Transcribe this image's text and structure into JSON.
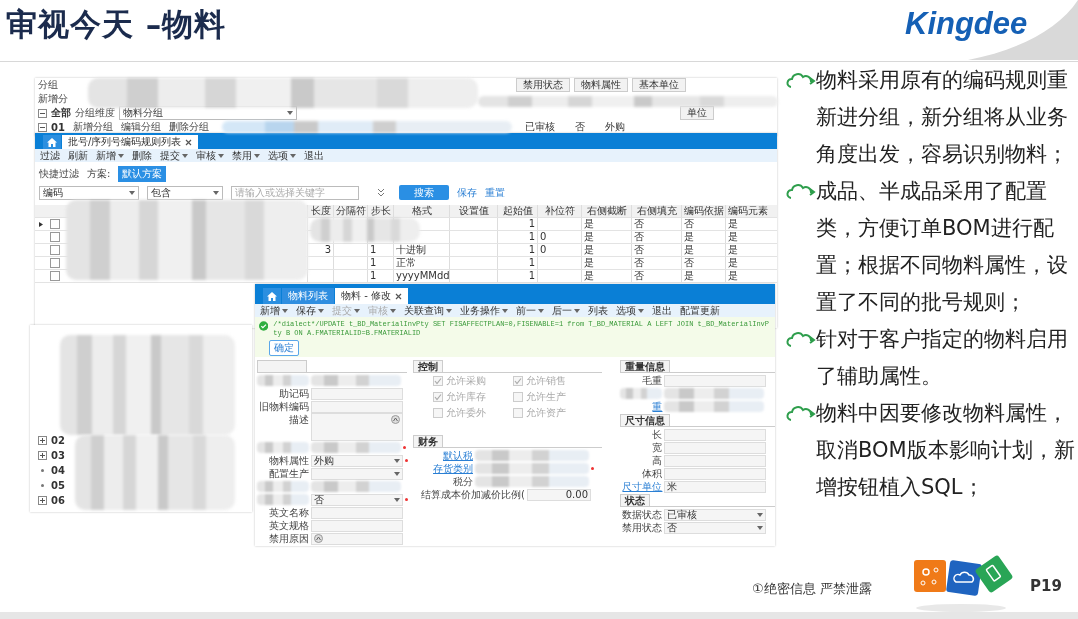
{
  "header": {
    "title": "审视今天 –物料",
    "logo": "Kingdee"
  },
  "group_window": {
    "labels": [
      "分组",
      "新增分"
    ],
    "tree_root": "全部",
    "dimension_label": "分组维度",
    "dimension_value": "物料分组",
    "node_code": "01",
    "node_actions": [
      "新增分组",
      "编辑分组",
      "删除分组"
    ],
    "columns": [
      "禁用状态",
      "物料属性",
      "基本单位"
    ],
    "columns_2": [
      "单位"
    ],
    "row": [
      "已审核",
      "否",
      "外购"
    ]
  },
  "rule_list_window": {
    "tabs": [
      {
        "label": "批号/序列号编码规则列表",
        "selected": true,
        "closable": true
      }
    ],
    "toolbar": [
      {
        "label": "过滤",
        "dropdown": false
      },
      {
        "label": "刷新",
        "dropdown": false
      },
      {
        "label": "新增",
        "dropdown": true
      },
      {
        "label": "删除",
        "dropdown": false
      },
      {
        "label": "提交",
        "dropdown": true
      },
      {
        "label": "审核",
        "dropdown": true
      },
      {
        "label": "禁用",
        "dropdown": true
      },
      {
        "label": "选项",
        "dropdown": true
      },
      {
        "label": "退出",
        "dropdown": false
      }
    ],
    "quick_filter": "快捷过滤",
    "scheme_label": "方案:",
    "scheme": "默认方案",
    "filter": {
      "field": "编码",
      "operator": "包含",
      "placeholder": "请输入或选择关键字"
    },
    "search_button": "搜索",
    "links": [
      "保存",
      "重置"
    ],
    "table": {
      "columns": [
        "长度",
        "分隔符",
        "步长",
        "格式",
        "设置值",
        "起始值",
        "补位符",
        "右侧截断",
        "右侧填充",
        "编码依据",
        "编码元素"
      ],
      "rows": [
        {
          "current": true,
          "checked": false,
          "cells": [
            "",
            "",
            "",
            "",
            "",
            "1",
            "",
            "是",
            "否",
            "否",
            "是"
          ]
        },
        {
          "current": false,
          "checked": false,
          "cells": [
            "",
            "",
            "",
            "",
            "",
            "1",
            "0",
            "是",
            "否",
            "是",
            "是"
          ]
        },
        {
          "current": false,
          "checked": false,
          "cells": [
            "3",
            "",
            "1",
            "十进制",
            "",
            "1",
            "0",
            "是",
            "否",
            "是",
            "是"
          ]
        },
        {
          "current": false,
          "checked": false,
          "cells": [
            "",
            "",
            "1",
            "正常",
            "",
            "1",
            "",
            "是",
            "否",
            "否",
            "是"
          ]
        },
        {
          "current": false,
          "checked": false,
          "cells": [
            "",
            "",
            "1",
            "yyyyMMdd",
            "",
            "1",
            "",
            "是",
            "否",
            "是",
            "是"
          ]
        }
      ]
    }
  },
  "material_window": {
    "tabs": [
      {
        "label": "物料列表",
        "selected": false,
        "closable": false
      },
      {
        "label": "物料 - 修改",
        "selected": true,
        "closable": true
      }
    ],
    "toolbar": [
      {
        "label": "新增",
        "dropdown": true,
        "disabled": false
      },
      {
        "label": "保存",
        "dropdown": true,
        "disabled": false
      },
      {
        "label": "提交",
        "dropdown": true,
        "disabled": true
      },
      {
        "label": "审核",
        "dropdown": true,
        "disabled": true
      },
      {
        "label": "关联查询",
        "dropdown": true,
        "disabled": false
      },
      {
        "label": "业务操作",
        "dropdown": true,
        "disabled": false
      },
      {
        "label": "前一",
        "dropdown": true,
        "disabled": false
      },
      {
        "label": "后一",
        "dropdown": true,
        "disabled": false
      },
      {
        "label": "列表",
        "dropdown": false,
        "disabled": false
      },
      {
        "label": "选项",
        "dropdown": true,
        "disabled": false
      },
      {
        "label": "退出",
        "dropdown": false,
        "disabled": false
      },
      {
        "label": "配置更新",
        "dropdown": false,
        "disabled": false
      }
    ],
    "message": "/*dialect*/UPDATE  t_BD_MaterialInvPty SET FISAFFECTPLAN=0,FISENABLE=1 from T_BD_MATERIAL A LEFT  JOIN t_BD_MaterialInvPty B ON A.FMATERIALID=B.FMATERIALID",
    "ok_button": "确定",
    "basic": {
      "fields": [
        {
          "kind": "text",
          "obscured": true
        },
        {
          "label": "助记码",
          "kind": "text"
        },
        {
          "label": "旧物料编码",
          "kind": "text"
        },
        {
          "label": "描述",
          "kind": "textarea"
        },
        {
          "kind": "text",
          "required": true,
          "obscured": true
        },
        {
          "label": "物料属性",
          "kind": "select",
          "value": "外购",
          "required": true
        },
        {
          "label": "配置生产",
          "kind": "select"
        },
        {
          "kind": "text",
          "obscured": true
        },
        {
          "kind": "select",
          "value": "否",
          "required": true
        },
        {
          "label": "英文名称",
          "kind": "text"
        },
        {
          "label": "英文规格",
          "kind": "text"
        },
        {
          "label": "禁用原因",
          "kind": "lookup"
        }
      ]
    },
    "control": {
      "title": "控制",
      "options": [
        {
          "label": "允许采购",
          "checked": true
        },
        {
          "label": "允许销售",
          "checked": true
        },
        {
          "label": "允许库存",
          "checked": true
        },
        {
          "label": "允许生产",
          "checked": false
        },
        {
          "label": "允许委外",
          "checked": false
        },
        {
          "label": "允许资产",
          "checked": false
        }
      ]
    },
    "finance": {
      "title": "财务",
      "fields": [
        {
          "label": "默认税",
          "kind": "text",
          "link": true,
          "obscured": true
        },
        {
          "label": "存货类别",
          "kind": "text",
          "link": true,
          "required": true,
          "obscured": true
        },
        {
          "label": "税分",
          "kind": "text",
          "obscured": true
        },
        {
          "label": "结算成本价加减价比例(",
          "kind": "text",
          "value": "0.00"
        }
      ]
    },
    "weight": {
      "title": "重量信息",
      "fields": [
        {
          "label": "毛重",
          "kind": "text"
        },
        {
          "kind": "text",
          "obscured": true
        },
        {
          "label": "重",
          "kind": "text",
          "link": true,
          "obscured": true
        }
      ]
    },
    "size": {
      "title": "尺寸信息",
      "fields": [
        {
          "label": "长",
          "kind": "text"
        },
        {
          "label": "宽",
          "kind": "text"
        },
        {
          "label": "高",
          "kind": "text"
        },
        {
          "label": "体积",
          "kind": "text"
        },
        {
          "label": "尺寸单位",
          "kind": "text",
          "link": true,
          "value": "米"
        }
      ]
    },
    "status": {
      "title": "状态",
      "fields": [
        {
          "label": "数据状态",
          "kind": "select",
          "value": "已审核"
        },
        {
          "label": "禁用状态",
          "kind": "select",
          "value": "否"
        }
      ]
    }
  },
  "tree_panel": {
    "nodes": [
      {
        "code": "02",
        "expandable": true
      },
      {
        "code": "03",
        "expandable": true
      },
      {
        "code": "04",
        "expandable": false
      },
      {
        "code": "05",
        "expandable": false
      },
      {
        "code": "06",
        "expandable": true
      }
    ]
  },
  "bullets": [
    "物料采用原有的编码规则重新进分组，新分组将从业务角度出发，容易识别物料；",
    "成品、半成品采用了配置类，方便订单BOM进行配置；根据不同物料属性，设置了不同的批号规则；",
    "针对于客户指定的物料启用了辅助属性。",
    "物料中因要修改物料属性，取消BOM版本影响计划，新增按钮植入SQL；"
  ],
  "footer": {
    "notice": "①绝密信息 严禁泄露",
    "page": "P19"
  }
}
